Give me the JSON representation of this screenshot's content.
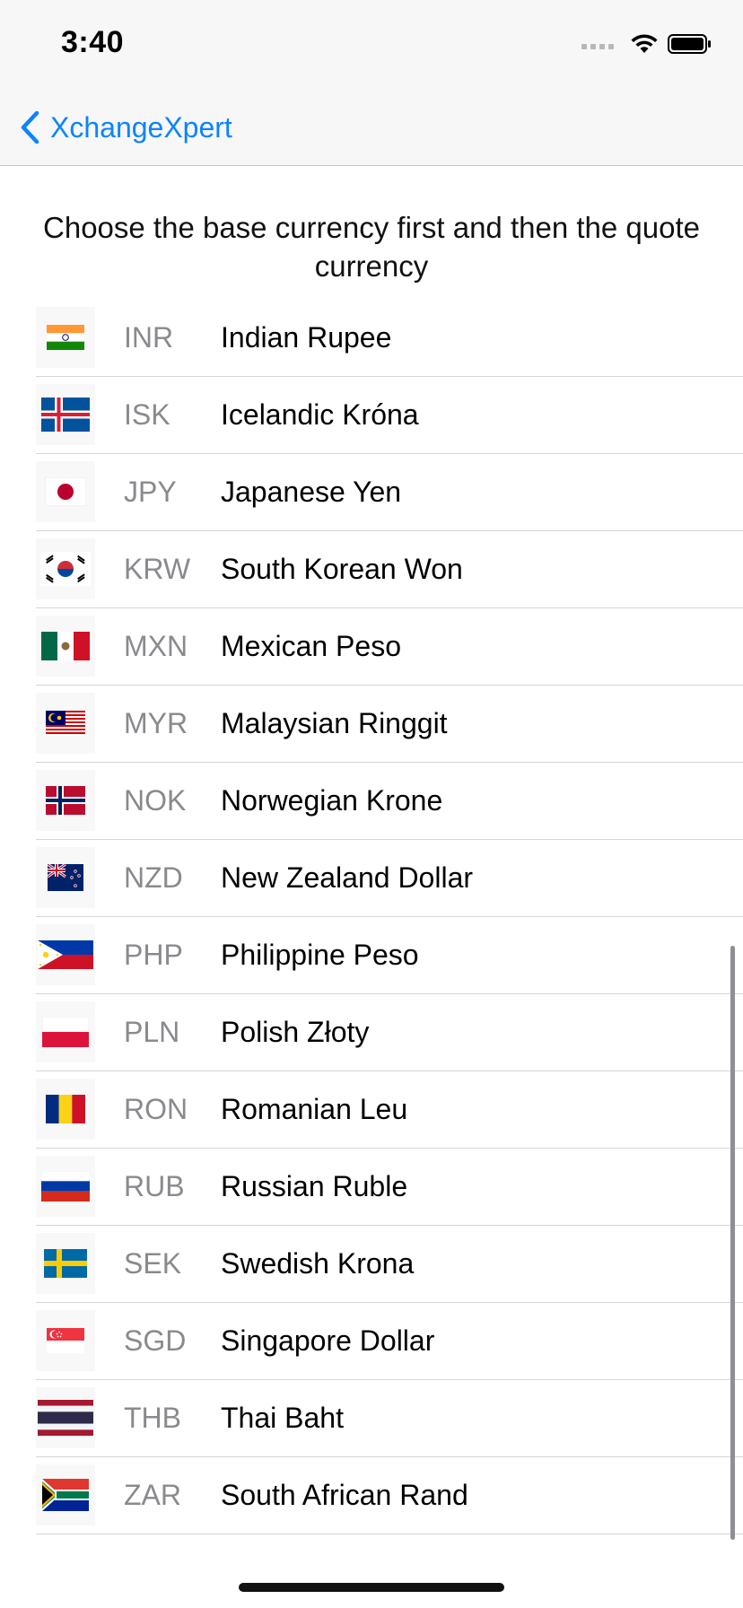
{
  "status_bar": {
    "time": "3:40",
    "icons": [
      "cellular-signal-icon",
      "wifi-icon",
      "battery-icon"
    ]
  },
  "nav": {
    "back_label": "XchangeXpert",
    "back_icon": "chevron-left-icon",
    "accent_color": "#0a84ff"
  },
  "instructions": "Choose the base currency first and then the quote currency",
  "currencies": [
    {
      "code": "INR",
      "name": "Indian Rupee",
      "flag": "flag-india-icon"
    },
    {
      "code": "ISK",
      "name": "Icelandic Króna",
      "flag": "flag-iceland-icon"
    },
    {
      "code": "JPY",
      "name": "Japanese Yen",
      "flag": "flag-japan-icon"
    },
    {
      "code": "KRW",
      "name": "South Korean Won",
      "flag": "flag-south-korea-icon"
    },
    {
      "code": "MXN",
      "name": "Mexican Peso",
      "flag": "flag-mexico-icon"
    },
    {
      "code": "MYR",
      "name": "Malaysian Ringgit",
      "flag": "flag-malaysia-icon"
    },
    {
      "code": "NOK",
      "name": "Norwegian Krone",
      "flag": "flag-norway-icon"
    },
    {
      "code": "NZD",
      "name": "New Zealand Dollar",
      "flag": "flag-new-zealand-icon"
    },
    {
      "code": "PHP",
      "name": "Philippine Peso",
      "flag": "flag-philippines-icon"
    },
    {
      "code": "PLN",
      "name": "Polish Złoty",
      "flag": "flag-poland-icon"
    },
    {
      "code": "RON",
      "name": "Romanian Leu",
      "flag": "flag-romania-icon"
    },
    {
      "code": "RUB",
      "name": "Russian Ruble",
      "flag": "flag-russia-icon"
    },
    {
      "code": "SEK",
      "name": "Swedish Krona",
      "flag": "flag-sweden-icon"
    },
    {
      "code": "SGD",
      "name": "Singapore Dollar",
      "flag": "flag-singapore-icon"
    },
    {
      "code": "THB",
      "name": "Thai Baht",
      "flag": "flag-thailand-icon"
    },
    {
      "code": "ZAR",
      "name": "South African Rand",
      "flag": "flag-south-africa-icon"
    }
  ]
}
